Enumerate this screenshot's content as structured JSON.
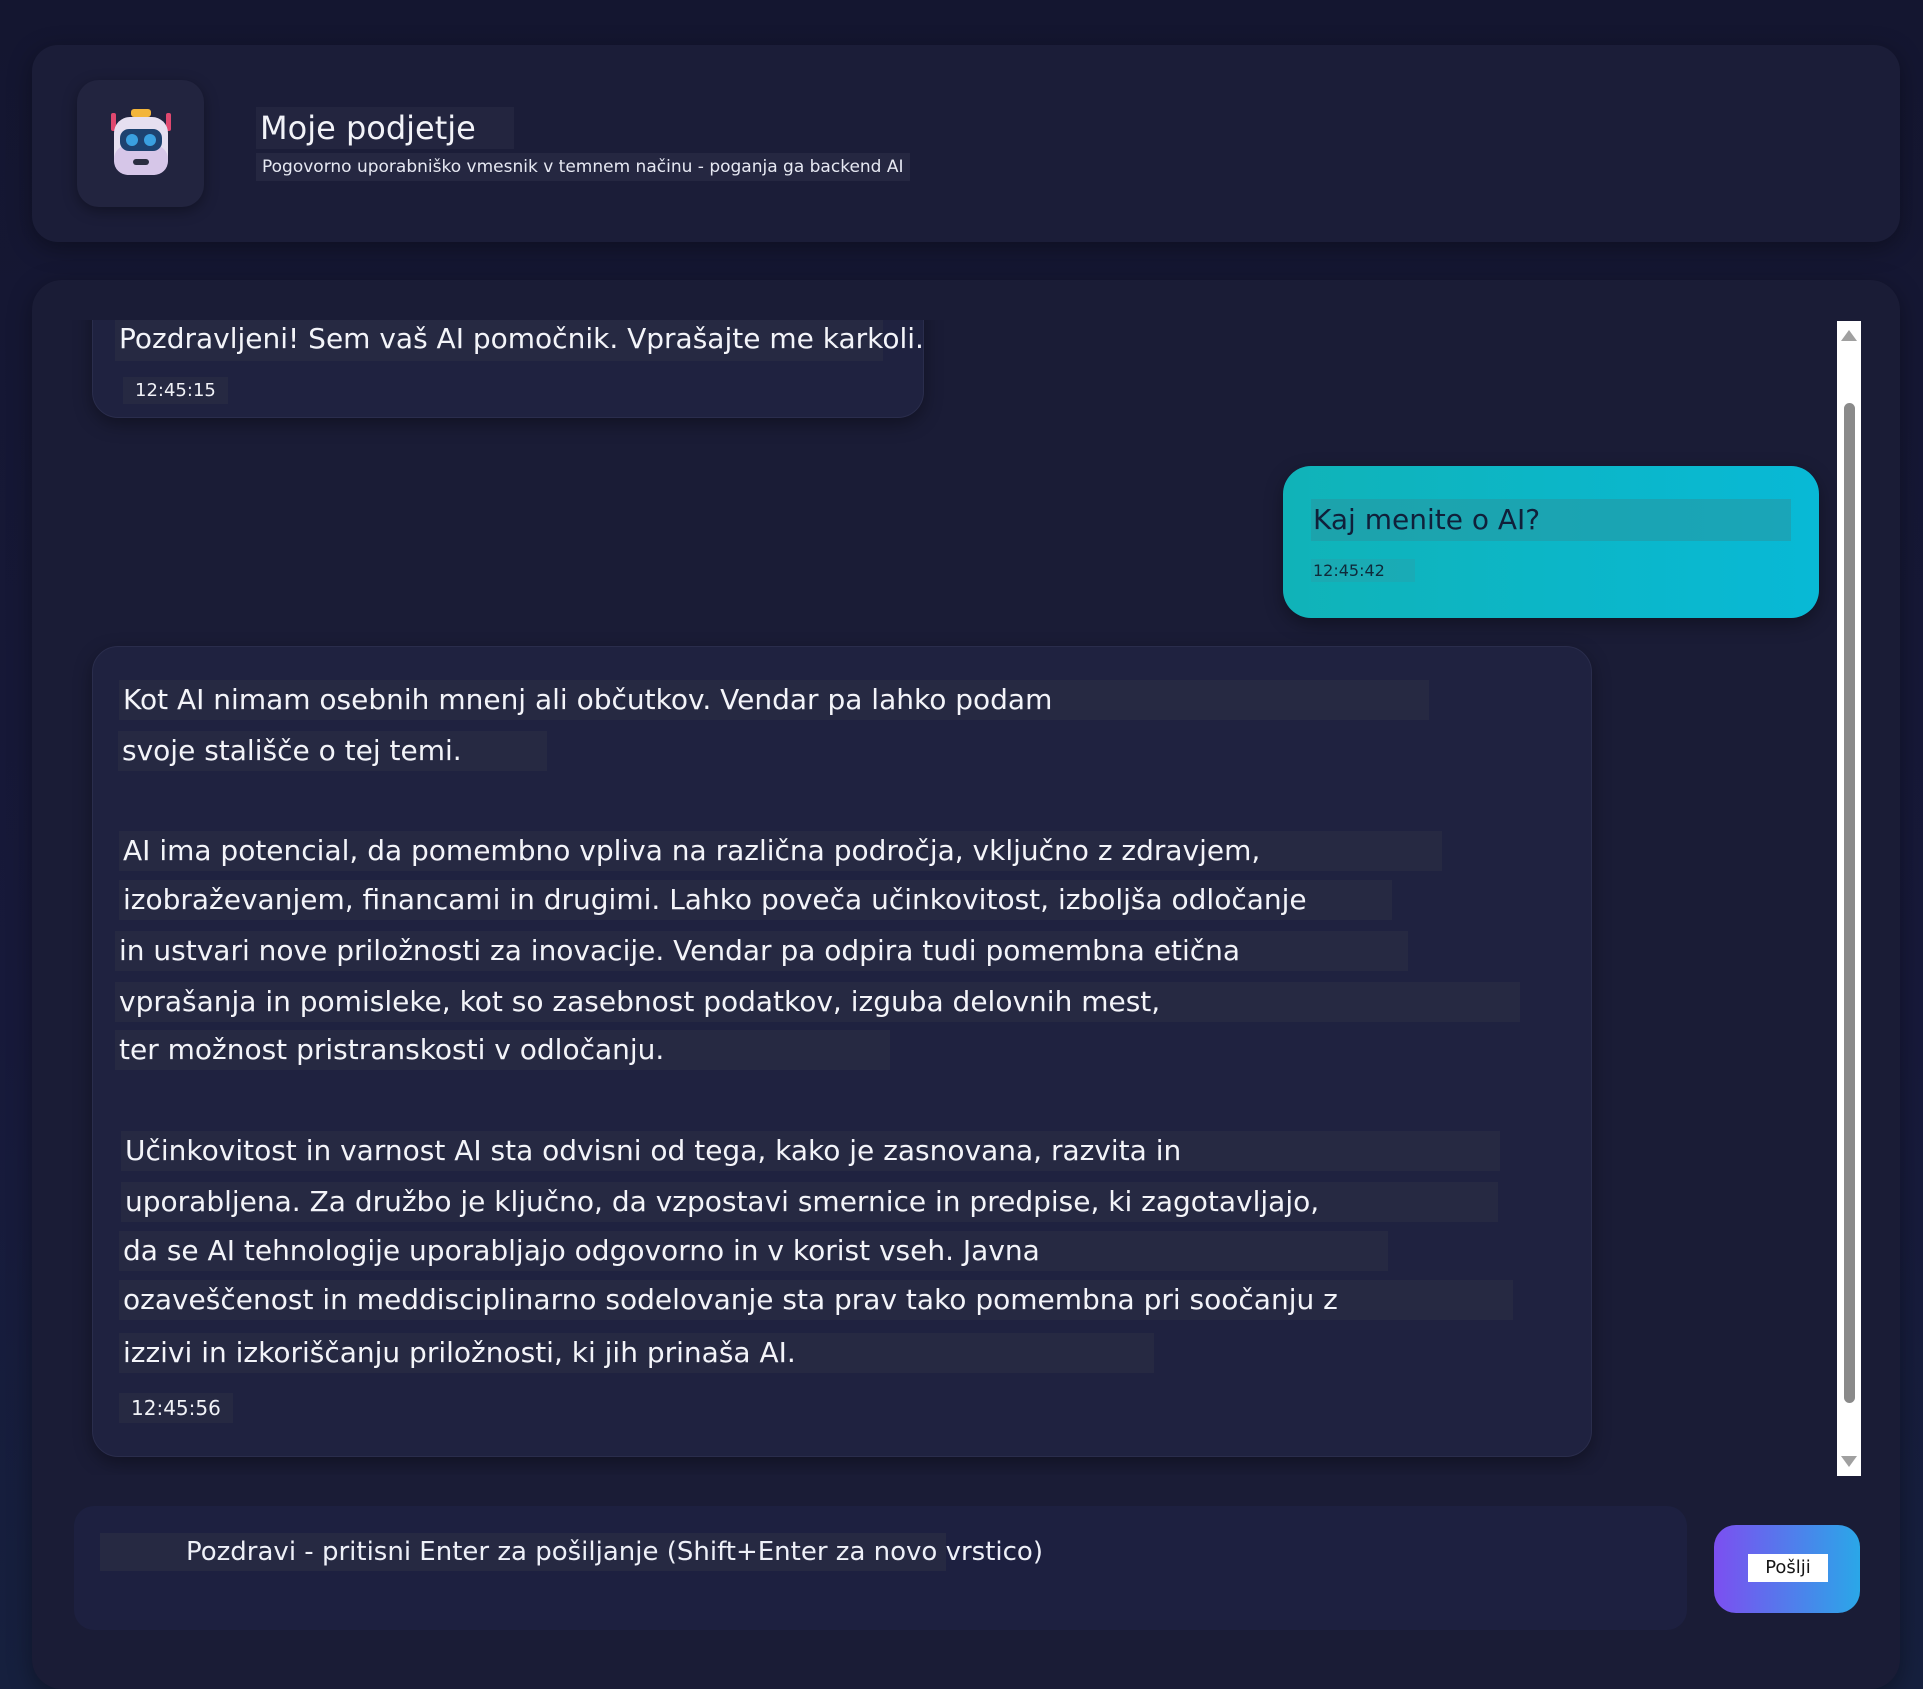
{
  "header": {
    "title": "Moje podjetje",
    "subtitle": "Pogovorno uporabniško vmesnik v temnem načinu - poganja ga backend AI",
    "avatar_icon": "robot-icon"
  },
  "messages": [
    {
      "role": "assistant",
      "lines": [
        "Pozdravljeni! Sem vaš AI pomočnik. Vprašajte me karkoli."
      ],
      "time": "12:45:15"
    },
    {
      "role": "user",
      "lines": [
        "Kaj menite o AI?"
      ],
      "time": "12:45:42"
    },
    {
      "role": "assistant",
      "lines": [
        "Kot AI nimam osebnih mnenj ali občutkov. Vendar pa lahko podam",
        "svoje stališče o tej temi.",
        "AI ima potencial, da pomembno vpliva na različna področja, vključno z zdravjem,",
        "izobraževanjem, financami in drugimi. Lahko poveča učinkovitost, izboljša odločanje",
        "in ustvari nove priložnosti za inovacije. Vendar pa odpira tudi pomembna etična",
        "vprašanja in pomisleke, kot so zasebnost podatkov, izguba delovnih mest,",
        "ter možnost pristranskosti v odločanju.",
        "Učinkovitost in varnost AI sta odvisni od tega, kako je zasnovana, razvita in",
        "uporabljena. Za družbo je ključno, da vzpostavi smernice in predpise, ki zagotavljajo,",
        "da se AI tehnologije uporabljajo odgovorno in v korist vseh. Javna",
        "ozaveščenost in meddisciplinarno sodelovanje sta prav tako pomembna pri soočanju z",
        "izzivi in izkoriščanju priložnosti, ki jih prinaša AI."
      ],
      "time": "12:45:56"
    }
  ],
  "input": {
    "placeholder": "Pozdravi - pritisni Enter za pošiljanje (Shift+Enter za novo vrstico)"
  },
  "send_button": {
    "label": "Pošlji"
  },
  "colors": {
    "background": "#15172e",
    "panel": "#1a1c36",
    "user_bubble": "#08b9d6",
    "send_gradient_start": "#7c4ff0",
    "send_gradient_end": "#2aa7e8"
  }
}
